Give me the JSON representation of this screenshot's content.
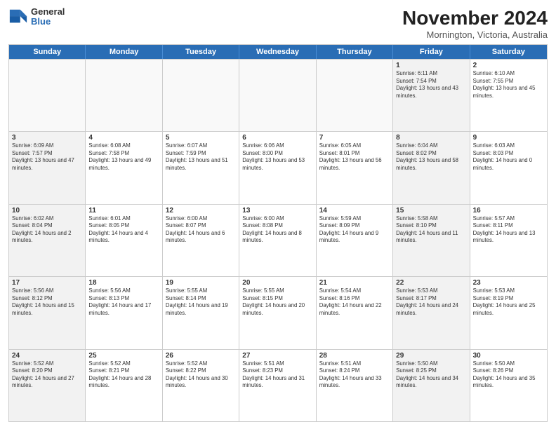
{
  "logo": {
    "general": "General",
    "blue": "Blue"
  },
  "header": {
    "title": "November 2024",
    "subtitle": "Mornington, Victoria, Australia"
  },
  "days_of_week": [
    "Sunday",
    "Monday",
    "Tuesday",
    "Wednesday",
    "Thursday",
    "Friday",
    "Saturday"
  ],
  "weeks": [
    [
      {
        "day": "",
        "empty": true
      },
      {
        "day": "",
        "empty": true
      },
      {
        "day": "",
        "empty": true
      },
      {
        "day": "",
        "empty": true
      },
      {
        "day": "",
        "empty": true
      },
      {
        "day": "1",
        "sunrise": "6:11 AM",
        "sunset": "7:54 PM",
        "daylight": "13 hours and 43 minutes."
      },
      {
        "day": "2",
        "sunrise": "6:10 AM",
        "sunset": "7:55 PM",
        "daylight": "13 hours and 45 minutes."
      }
    ],
    [
      {
        "day": "3",
        "sunrise": "6:09 AM",
        "sunset": "7:57 PM",
        "daylight": "13 hours and 47 minutes."
      },
      {
        "day": "4",
        "sunrise": "6:08 AM",
        "sunset": "7:58 PM",
        "daylight": "13 hours and 49 minutes."
      },
      {
        "day": "5",
        "sunrise": "6:07 AM",
        "sunset": "7:59 PM",
        "daylight": "13 hours and 51 minutes."
      },
      {
        "day": "6",
        "sunrise": "6:06 AM",
        "sunset": "8:00 PM",
        "daylight": "13 hours and 53 minutes."
      },
      {
        "day": "7",
        "sunrise": "6:05 AM",
        "sunset": "8:01 PM",
        "daylight": "13 hours and 56 minutes."
      },
      {
        "day": "8",
        "sunrise": "6:04 AM",
        "sunset": "8:02 PM",
        "daylight": "13 hours and 58 minutes."
      },
      {
        "day": "9",
        "sunrise": "6:03 AM",
        "sunset": "8:03 PM",
        "daylight": "14 hours and 0 minutes."
      }
    ],
    [
      {
        "day": "10",
        "sunrise": "6:02 AM",
        "sunset": "8:04 PM",
        "daylight": "14 hours and 2 minutes."
      },
      {
        "day": "11",
        "sunrise": "6:01 AM",
        "sunset": "8:05 PM",
        "daylight": "14 hours and 4 minutes."
      },
      {
        "day": "12",
        "sunrise": "6:00 AM",
        "sunset": "8:07 PM",
        "daylight": "14 hours and 6 minutes."
      },
      {
        "day": "13",
        "sunrise": "6:00 AM",
        "sunset": "8:08 PM",
        "daylight": "14 hours and 8 minutes."
      },
      {
        "day": "14",
        "sunrise": "5:59 AM",
        "sunset": "8:09 PM",
        "daylight": "14 hours and 9 minutes."
      },
      {
        "day": "15",
        "sunrise": "5:58 AM",
        "sunset": "8:10 PM",
        "daylight": "14 hours and 11 minutes."
      },
      {
        "day": "16",
        "sunrise": "5:57 AM",
        "sunset": "8:11 PM",
        "daylight": "14 hours and 13 minutes."
      }
    ],
    [
      {
        "day": "17",
        "sunrise": "5:56 AM",
        "sunset": "8:12 PM",
        "daylight": "14 hours and 15 minutes."
      },
      {
        "day": "18",
        "sunrise": "5:56 AM",
        "sunset": "8:13 PM",
        "daylight": "14 hours and 17 minutes."
      },
      {
        "day": "19",
        "sunrise": "5:55 AM",
        "sunset": "8:14 PM",
        "daylight": "14 hours and 19 minutes."
      },
      {
        "day": "20",
        "sunrise": "5:55 AM",
        "sunset": "8:15 PM",
        "daylight": "14 hours and 20 minutes."
      },
      {
        "day": "21",
        "sunrise": "5:54 AM",
        "sunset": "8:16 PM",
        "daylight": "14 hours and 22 minutes."
      },
      {
        "day": "22",
        "sunrise": "5:53 AM",
        "sunset": "8:17 PM",
        "daylight": "14 hours and 24 minutes."
      },
      {
        "day": "23",
        "sunrise": "5:53 AM",
        "sunset": "8:19 PM",
        "daylight": "14 hours and 25 minutes."
      }
    ],
    [
      {
        "day": "24",
        "sunrise": "5:52 AM",
        "sunset": "8:20 PM",
        "daylight": "14 hours and 27 minutes."
      },
      {
        "day": "25",
        "sunrise": "5:52 AM",
        "sunset": "8:21 PM",
        "daylight": "14 hours and 28 minutes."
      },
      {
        "day": "26",
        "sunrise": "5:52 AM",
        "sunset": "8:22 PM",
        "daylight": "14 hours and 30 minutes."
      },
      {
        "day": "27",
        "sunrise": "5:51 AM",
        "sunset": "8:23 PM",
        "daylight": "14 hours and 31 minutes."
      },
      {
        "day": "28",
        "sunrise": "5:51 AM",
        "sunset": "8:24 PM",
        "daylight": "14 hours and 33 minutes."
      },
      {
        "day": "29",
        "sunrise": "5:50 AM",
        "sunset": "8:25 PM",
        "daylight": "14 hours and 34 minutes."
      },
      {
        "day": "30",
        "sunrise": "5:50 AM",
        "sunset": "8:26 PM",
        "daylight": "14 hours and 35 minutes."
      }
    ]
  ]
}
